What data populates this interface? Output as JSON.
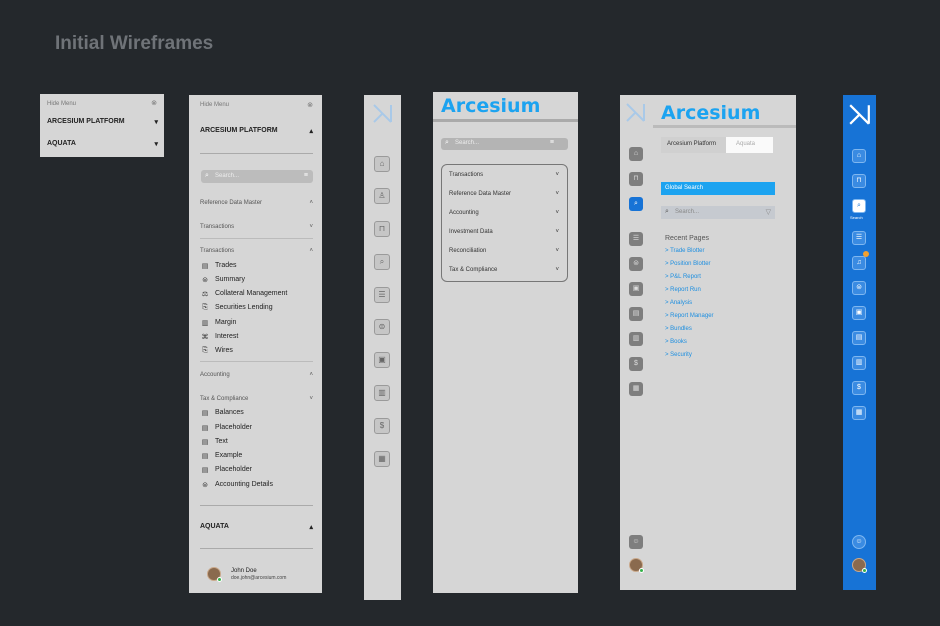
{
  "page_title": "Initial Wireframes",
  "brand": "Arcesium",
  "colors": {
    "background": "#24282c",
    "accent": "#1ca3f0",
    "rail_blue": "#1773d6"
  },
  "panel1": {
    "hide_menu": "Hide Menu",
    "platform": "ARCESIUM PLATFORM",
    "aquata": "AQUATA"
  },
  "panel2": {
    "hide_menu": "Hide Menu",
    "platform": "ARCESIUM PLATFORM",
    "search_placeholder": "Search...",
    "sections": {
      "ref_data": "Reference Data Master",
      "transactions1": "Transactions",
      "transactions2": "Transactions",
      "accounting": "Accounting",
      "tax": "Tax & Compliance"
    },
    "transactions_items": [
      "Trades",
      "Summary",
      "Collateral Management",
      "Securities Lending",
      "Margin",
      "Interest",
      "Wires"
    ],
    "tax_items": [
      "Balances",
      "Placeholder",
      "Text",
      "Example",
      "Placeholder",
      "Accounting Details"
    ],
    "aquata": "AQUATA",
    "user": {
      "name": "John Doe",
      "email": "doe.john@arcesium.com"
    }
  },
  "panel4": {
    "brand": "Arcesium",
    "search_placeholder": "Search...",
    "menu": [
      "Transactions",
      "Reference Data Master",
      "Accounting",
      "Investment Data",
      "Reconciliation",
      "Tax & Compliance"
    ]
  },
  "panel5": {
    "brand": "Arcesium",
    "seg_a": "Arcesium Platform",
    "seg_b": "Aquata",
    "global_search": "Global Search",
    "search_placeholder": "Search...",
    "recent_title": "Recent Pages",
    "recent": [
      "> Trade Blotter",
      "> Position Blotter",
      "> P&L Report",
      "> Report Run",
      "> Analysis",
      "> Report Manager",
      "> Bundles",
      "> Books",
      "> Security"
    ]
  },
  "panel6": {
    "search_label": "Search"
  }
}
